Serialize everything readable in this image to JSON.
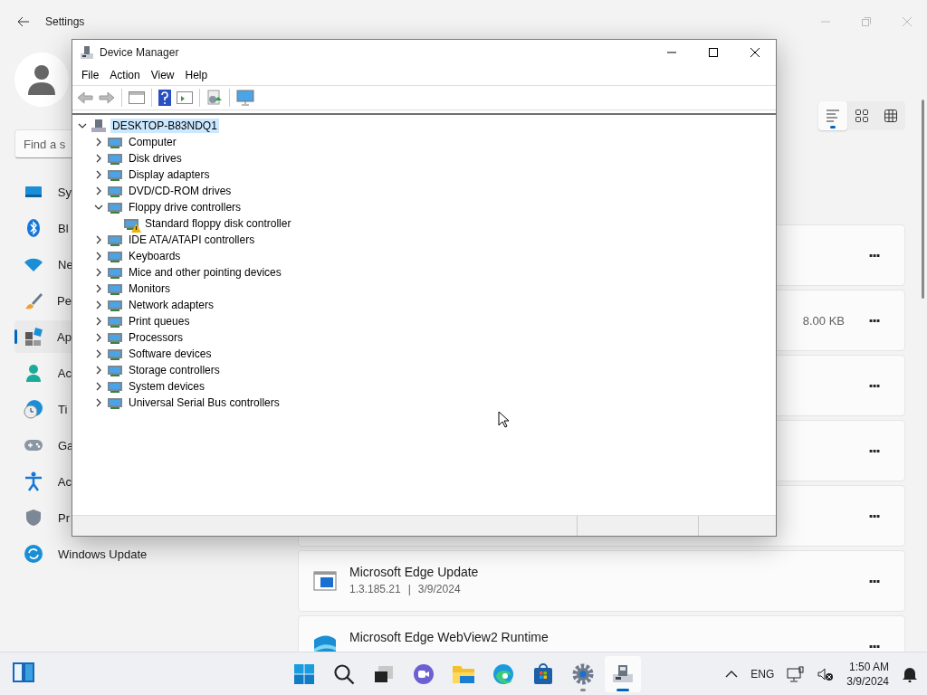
{
  "settings": {
    "title": "Settings",
    "search": {
      "placeholder": "Find a s"
    },
    "nav": [
      {
        "label": "Sy",
        "selected": false
      },
      {
        "label": "Bl",
        "selected": false
      },
      {
        "label": "Ne",
        "selected": false
      },
      {
        "label": "Pe",
        "selected": false
      },
      {
        "label": "Ap",
        "selected": true
      },
      {
        "label": "Ac",
        "selected": false
      },
      {
        "label": "Ti",
        "selected": false
      },
      {
        "label": "Ga",
        "selected": false
      },
      {
        "label": "Ac",
        "selected": false
      },
      {
        "label": "Pr",
        "selected": false
      },
      {
        "label": "Windows Update",
        "selected": false
      }
    ],
    "view_options": [
      {
        "selected": true
      },
      {
        "selected": false
      },
      {
        "selected": false
      }
    ],
    "apps": [
      {
        "more": "···"
      },
      {
        "size": "8.00 KB",
        "more": "···"
      },
      {
        "more": "···"
      },
      {
        "more": "···"
      },
      {
        "more": "···"
      },
      {
        "name": "Microsoft Edge Update",
        "version": "1.3.185.21",
        "separator": "|",
        "date": "3/9/2024",
        "more": "···"
      },
      {
        "name": "Microsoft Edge WebView2 Runtime",
        "more": "···"
      }
    ]
  },
  "device_manager": {
    "title": "Device Manager",
    "menu": [
      "File",
      "Action",
      "View",
      "Help"
    ],
    "tree": {
      "label": "DESKTOP-B83NDQ1",
      "expanded": true,
      "selected": true,
      "children": [
        {
          "label": "Computer",
          "expanded": false,
          "selected": false
        },
        {
          "label": "Disk drives",
          "expanded": false,
          "selected": false
        },
        {
          "label": "Display adapters",
          "expanded": false,
          "selected": false
        },
        {
          "label": "DVD/CD-ROM drives",
          "expanded": false,
          "selected": false
        },
        {
          "label": "Floppy drive controllers",
          "expanded": true,
          "selected": false,
          "children": [
            {
              "label": "Standard floppy disk controller",
              "warning": true,
              "selected": false
            }
          ]
        },
        {
          "label": "IDE ATA/ATAPI controllers",
          "expanded": false,
          "selected": false
        },
        {
          "label": "Keyboards",
          "expanded": false,
          "selected": false
        },
        {
          "label": "Mice and other pointing devices",
          "expanded": false,
          "selected": false
        },
        {
          "label": "Monitors",
          "expanded": false,
          "selected": false
        },
        {
          "label": "Network adapters",
          "expanded": false,
          "selected": false
        },
        {
          "label": "Print queues",
          "expanded": false,
          "selected": false
        },
        {
          "label": "Processors",
          "expanded": false,
          "selected": false
        },
        {
          "label": "Software devices",
          "expanded": false,
          "selected": false
        },
        {
          "label": "Storage controllers",
          "expanded": false,
          "selected": false
        },
        {
          "label": "System devices",
          "expanded": false,
          "selected": false
        },
        {
          "label": "Universal Serial Bus controllers",
          "expanded": false,
          "selected": false
        }
      ]
    }
  },
  "taskbar": {
    "apps": [
      {
        "running": false,
        "active": false
      },
      {
        "running": false,
        "active": false
      },
      {
        "running": false,
        "active": false
      },
      {
        "running": false,
        "active": false
      },
      {
        "running": false,
        "active": false
      },
      {
        "running": false,
        "active": false
      },
      {
        "running": false,
        "active": false
      },
      {
        "running": true,
        "active": false
      },
      {
        "running": true,
        "active": true
      }
    ],
    "language": "ENG",
    "time": "1:50 AM",
    "date": "3/9/2024"
  }
}
